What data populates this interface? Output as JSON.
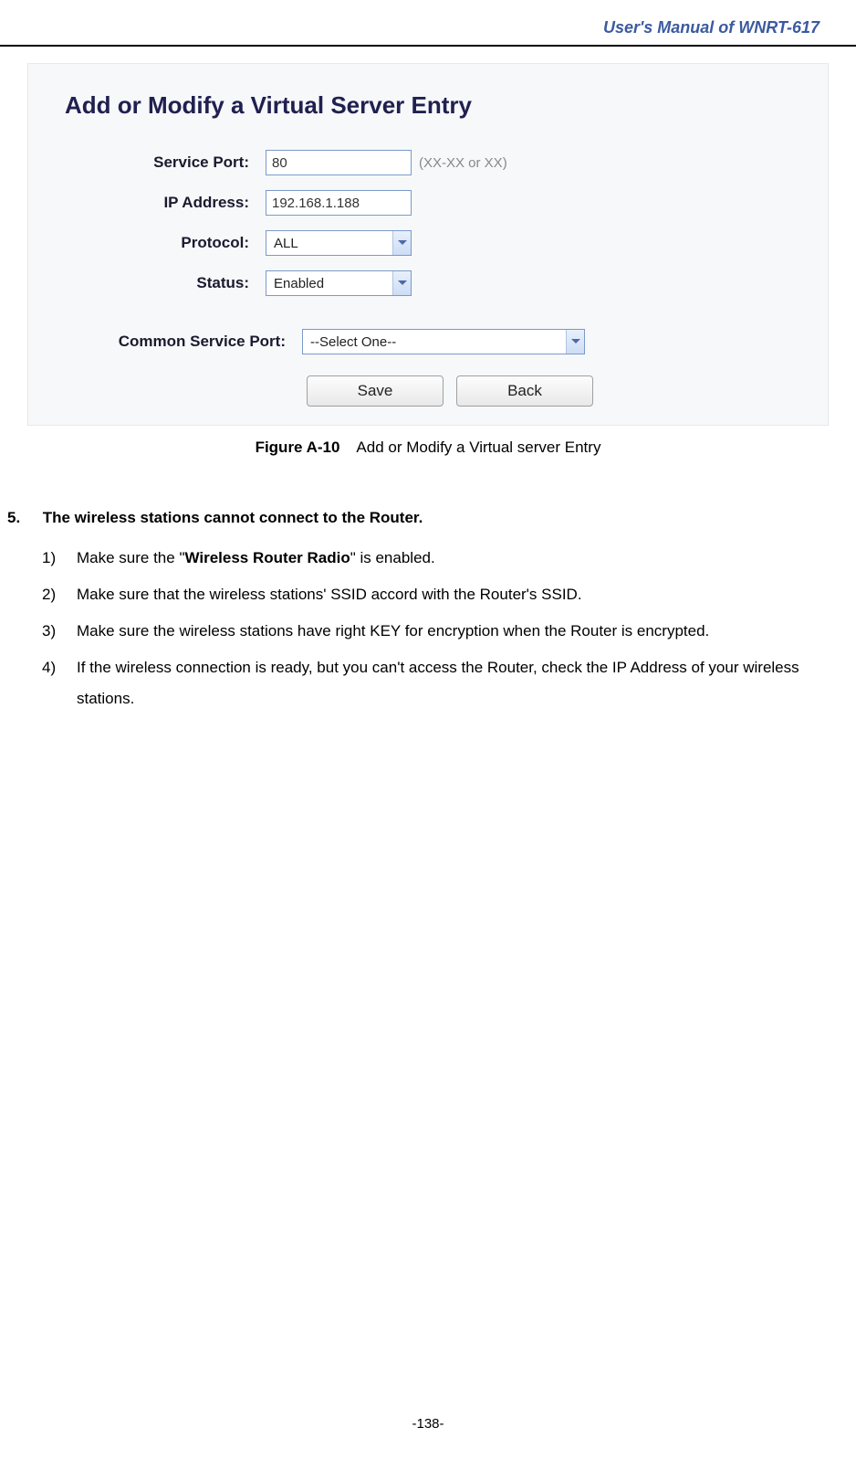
{
  "header": {
    "title": "User's Manual of WNRT-617"
  },
  "figure": {
    "title": "Add or Modify a Virtual Server Entry",
    "labels": {
      "service_port": "Service Port:",
      "ip_address": "IP Address:",
      "protocol": "Protocol:",
      "status": "Status:",
      "common_service_port": "Common Service Port:"
    },
    "values": {
      "service_port": "80",
      "ip_address": "192.168.1.188",
      "protocol": "ALL",
      "status": "Enabled",
      "common_service_port": "--Select One--"
    },
    "hints": {
      "service_port": "(XX-XX or XX)"
    },
    "buttons": {
      "save": "Save",
      "back": "Back"
    },
    "caption_bold": "Figure A-10",
    "caption_text": "Add or Modify a Virtual server Entry"
  },
  "section": {
    "num": "5.",
    "heading": "The wireless stations cannot connect to the Router.",
    "items": [
      {
        "num": "1)",
        "pre": "Make sure the \"",
        "bold": "Wireless Router Radio",
        "post": "\" is enabled."
      },
      {
        "num": "2)",
        "text": "Make sure that the wireless stations' SSID accord with the Router's SSID."
      },
      {
        "num": "3)",
        "text": "Make sure the wireless stations have right KEY for encryption when the Router is encrypted."
      },
      {
        "num": "4)",
        "text": "If the wireless connection is ready, but you can't access the Router, check the IP Address of your wireless stations."
      }
    ]
  },
  "footer": {
    "page_number": "-138-"
  }
}
